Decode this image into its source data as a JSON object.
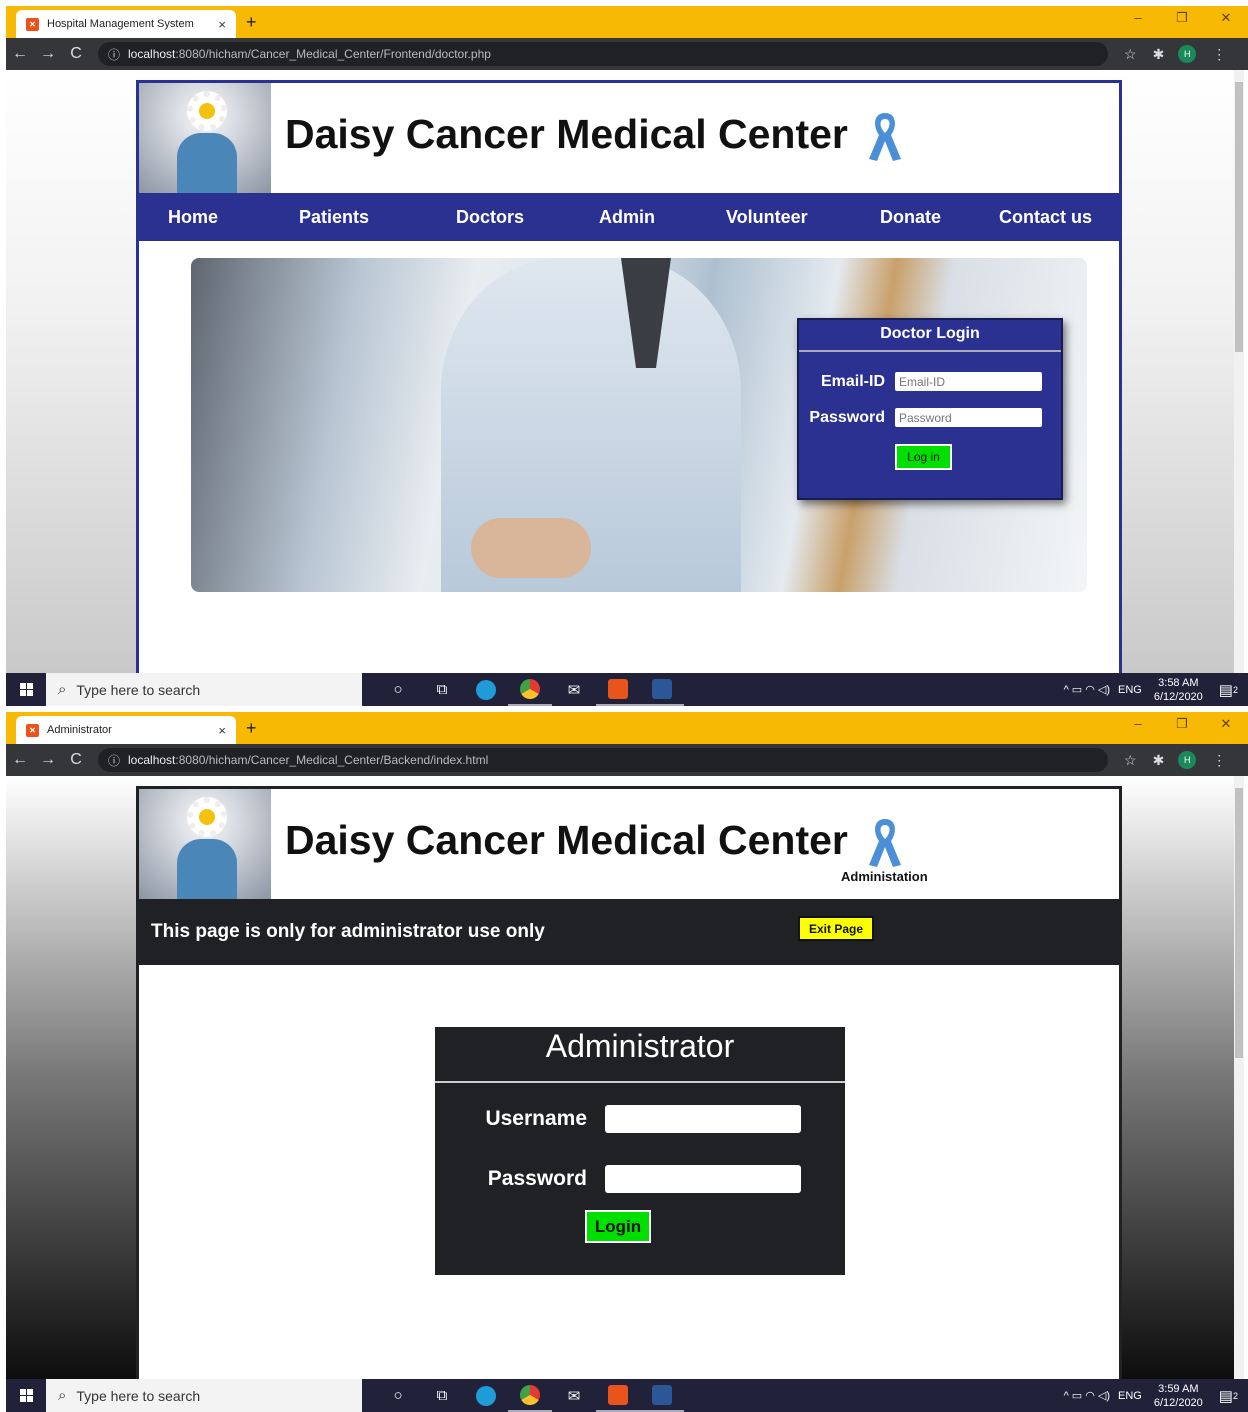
{
  "screens": [
    {
      "browser": {
        "tab_title": "Hospital Management System",
        "url_host": "localhost",
        "url_rest": ":8080/hicham/Cancer_Medical_Center/Frontend/doctor.php"
      },
      "site": {
        "title": "Daisy Cancer Medical Center",
        "nav": [
          "Home",
          "Patients",
          "Doctors",
          "Admin",
          "Volunteer",
          "Donate",
          "Contact us"
        ],
        "login": {
          "heading": "Doctor Login",
          "email_label": "Email-ID",
          "email_placeholder": "Email-ID",
          "password_label": "Password",
          "password_placeholder": "Password",
          "button": "Log in"
        }
      },
      "taskbar": {
        "search_placeholder": "Type here to search",
        "lang": "ENG",
        "time": "3:58 AM",
        "date": "6/12/2020",
        "notifications": "2"
      }
    },
    {
      "browser": {
        "tab_title": "Administrator",
        "url_host": "localhost",
        "url_rest": ":8080/hicham/Cancer_Medical_Center/Backend/index.html"
      },
      "site": {
        "title": "Daisy Cancer Medical Center",
        "subtitle": "Administation",
        "notice": "This page is only for administrator use only",
        "exit_button": "Exit Page",
        "login": {
          "heading": "Administrator",
          "username_label": "Username",
          "password_label": "Password",
          "button": "Login"
        }
      },
      "taskbar": {
        "search_placeholder": "Type here to search",
        "lang": "ENG",
        "time": "3:59 AM",
        "date": "6/12/2020",
        "notifications": "2"
      }
    }
  ],
  "colors": {
    "tab_bar": "#f7b903",
    "nav_blue": "#2b3190",
    "admin_dark": "#202124",
    "login_green": "#00e000",
    "exit_yellow": "#fcff00"
  },
  "icons": [
    "back-arrow-icon",
    "forward-arrow-icon",
    "reload-icon",
    "info-icon",
    "star-icon",
    "extensions-icon",
    "menu-dots-icon",
    "windows-start-icon",
    "search-icon",
    "cortana-icon",
    "task-view-icon",
    "edge-icon",
    "chrome-icon",
    "mail-icon",
    "xampp-icon",
    "word-icon",
    "ribbon-icon"
  ]
}
